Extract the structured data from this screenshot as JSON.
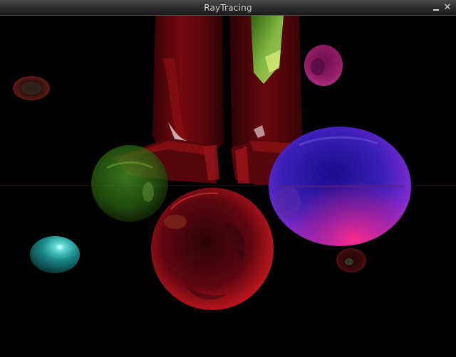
{
  "window": {
    "title": "RayTracing",
    "controls": {
      "minimize_icon": "minimize-icon",
      "close_icon": "close-icon",
      "close_glyph": "✕"
    }
  },
  "scene": {
    "description_colors": {
      "background": "#000000",
      "green_sphere": "#3f8f1f",
      "red_sphere": "#b0141c",
      "blue_sphere": "#2a20c8",
      "teal_sphere": "#1fa7a3",
      "magenta_sphere": "#b0207a",
      "red_drapes": "#8a0d12"
    }
  }
}
